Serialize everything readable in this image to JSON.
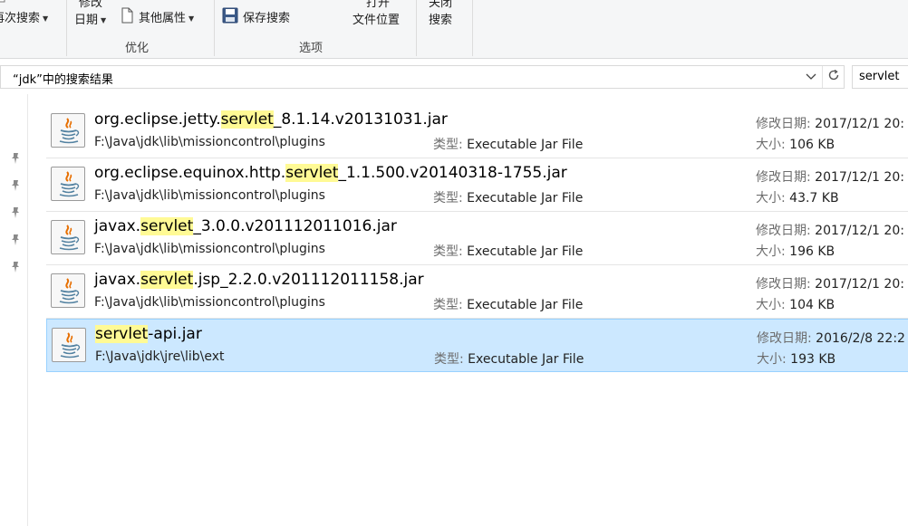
{
  "ribbon": {
    "search_again_label": "再次搜索",
    "modified_date_top": "修改",
    "modified_date_label": "日期",
    "other_props_label": "其他属性",
    "save_search_label": "保存搜索",
    "open_location_top": "打开",
    "open_location_label": "文件位置",
    "close_search_top": "关闭",
    "close_search_label": "搜索",
    "group_optimize": "优化",
    "group_options": "选项"
  },
  "address": {
    "text": "“jdk”中的搜索结果",
    "dropdown_icon": "chevron-down-icon",
    "refresh_icon": "refresh-icon"
  },
  "search": {
    "value": "servlet"
  },
  "labels": {
    "type": "类型:",
    "modified": "修改日期:",
    "size": "大小:"
  },
  "results": [
    {
      "pre": "org.eclipse.jetty.",
      "match": "servlet",
      "post": "_8.1.14.v20131031.jar",
      "path": "F:\\Java\\jdk\\lib\\missioncontrol\\plugins",
      "type": "Executable Jar File",
      "modified": "2017/12/1 20:",
      "size": "106 KB"
    },
    {
      "pre": "org.eclipse.equinox.http.",
      "match": "servlet",
      "post": "_1.1.500.v20140318-1755.jar",
      "path": "F:\\Java\\jdk\\lib\\missioncontrol\\plugins",
      "type": "Executable Jar File",
      "modified": "2017/12/1 20:",
      "size": "43.7 KB"
    },
    {
      "pre": "javax.",
      "match": "servlet",
      "post": "_3.0.0.v201112011016.jar",
      "path": "F:\\Java\\jdk\\lib\\missioncontrol\\plugins",
      "type": "Executable Jar File",
      "modified": "2017/12/1 20:",
      "size": "196 KB"
    },
    {
      "pre": "javax.",
      "match": "servlet",
      "post": ".jsp_2.2.0.v201112011158.jar",
      "path": "F:\\Java\\jdk\\lib\\missioncontrol\\plugins",
      "type": "Executable Jar File",
      "modified": "2017/12/1 20:",
      "size": "104 KB"
    },
    {
      "pre": "",
      "match": "servlet",
      "post": "-api.jar",
      "path": "F:\\Java\\jdk\\jre\\lib\\ext",
      "type": "Executable Jar File",
      "modified": "2016/2/8 22:2",
      "size": "193 KB",
      "selected": true
    }
  ],
  "colors": {
    "highlight": "#fffa95",
    "selected_bg": "#cce8ff",
    "selected_border": "#99d1ff",
    "java_red": "#e76f00",
    "java_blue": "#5382a1"
  }
}
